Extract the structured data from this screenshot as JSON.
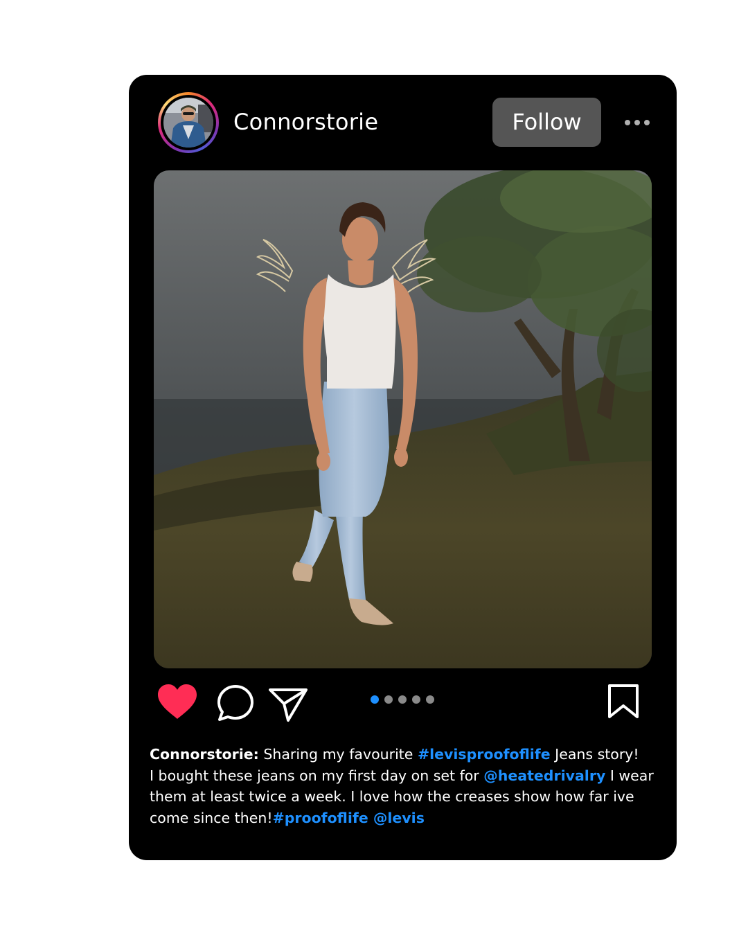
{
  "post": {
    "username": "Connorstorie",
    "follow_label": "Follow",
    "more_icon": "more-horizontal-icon",
    "photo_icon": "post-photo",
    "liked": true
  },
  "actions": {
    "like_icon": "heart-filled-icon",
    "comment_icon": "comment-icon",
    "share_icon": "send-icon",
    "save_icon": "bookmark-icon"
  },
  "carousel": {
    "total": 5,
    "active_index": 0
  },
  "caption": {
    "username": "Connorstorie:",
    "text_1": " Sharing my favourite ",
    "hashtag_1": "#levisproofoflife",
    "text_2": "  Jeans story!",
    "text_3": "I bought these jeans on my first day on set for  ",
    "mention_1": "@heatedrivalry",
    "text_4": " I wear them at least twice a week. I love how the creases show how far ive come since then!",
    "hashtag_2": "#proofoflife",
    "mention_2": " @levis"
  },
  "colors": {
    "card_background": "#000000",
    "follow_button": "#555555",
    "like_red": "#ff2d55",
    "link_blue": "#1e90ff",
    "dot_active": "#1e90ff",
    "dot_inactive": "#8a8a8a"
  }
}
